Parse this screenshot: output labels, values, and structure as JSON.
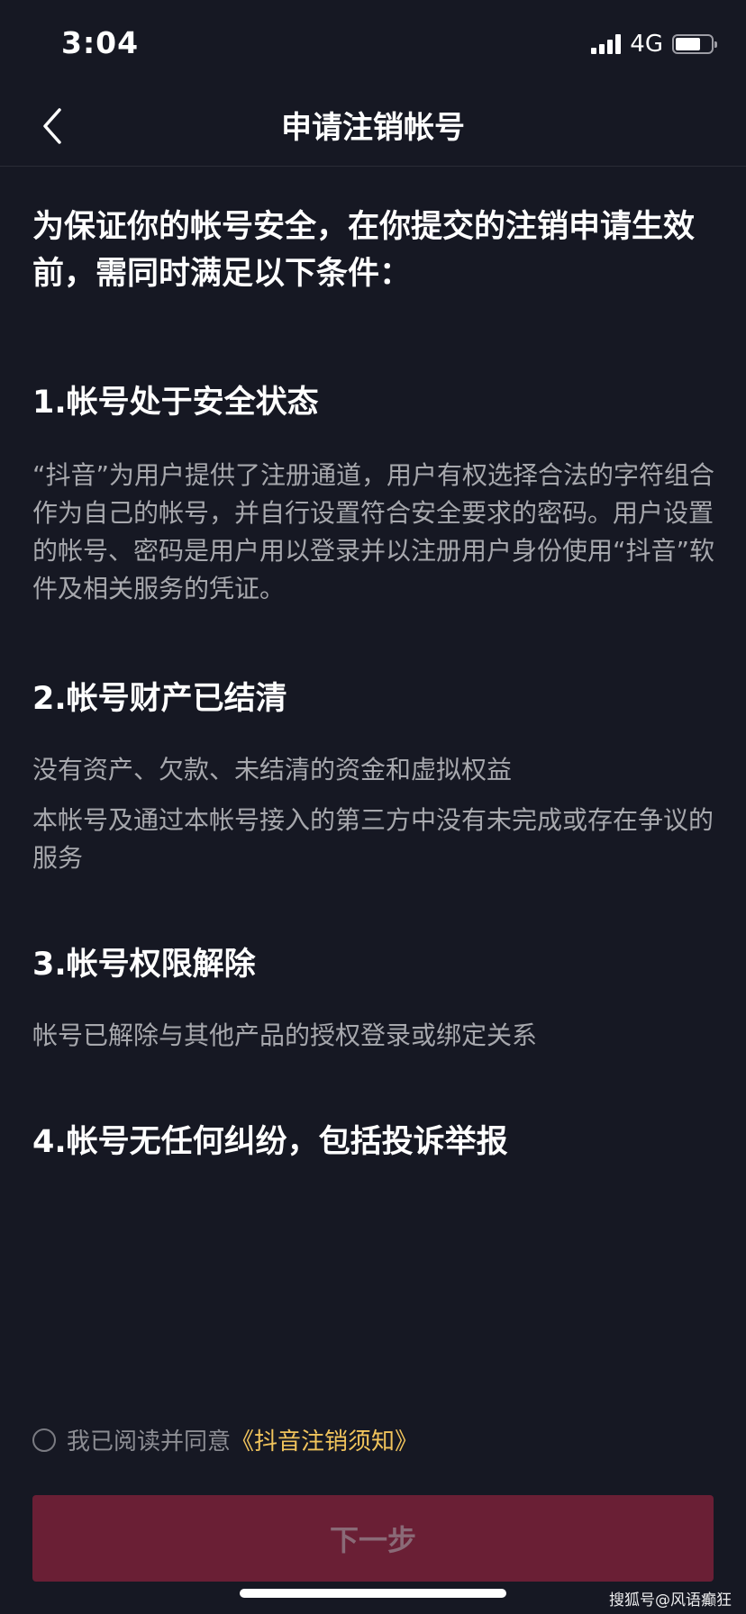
{
  "status_bar": {
    "time": "3:04",
    "network": "4G",
    "battery_level": 0.7
  },
  "nav": {
    "back_icon": "chevron-left-icon",
    "title": "申请注销帐号"
  },
  "intro": "为保证你的帐号安全，在你提交的注销申请生效前，需同时满足以下条件：",
  "sections": [
    {
      "title": "1.帐号处于安全状态",
      "paragraphs": [
        "“抖音”为用户提供了注册通道，用户有权选择合法的字符组合作为自己的帐号，并自行设置符合安全要求的密码。用户设置的帐号、密码是用户用以登录并以注册用户身份使用“抖音”软件及相关服务的凭证。"
      ]
    },
    {
      "title": "2.帐号财产已结清",
      "paragraphs": [
        "没有资产、欠款、未结清的资金和虚拟权益",
        "本帐号及通过本帐号接入的第三方中没有未完成或存在争议的服务"
      ]
    },
    {
      "title": "3.帐号权限解除",
      "paragraphs": [
        "帐号已解除与其他产品的授权登录或绑定关系"
      ]
    },
    {
      "title": "4.帐号无任何纠纷，包括投诉举报",
      "paragraphs": []
    }
  ],
  "agreement": {
    "checked": false,
    "text": "我已阅读并同意",
    "link_text": "《抖音注销须知》"
  },
  "next_button": "下一步",
  "watermark": "搜狐号@风语癫狂",
  "colors": {
    "background": "#161823",
    "link": "#f1c45c",
    "button_disabled": "#6a1f35"
  }
}
